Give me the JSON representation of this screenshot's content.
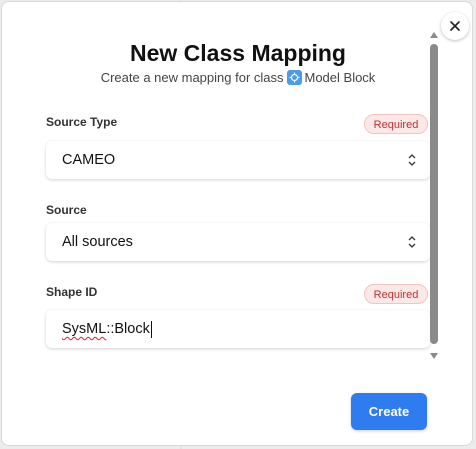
{
  "dialog": {
    "title": "New Class Mapping",
    "subtitle_prefix": "Create a new mapping for class",
    "class_icon": "model-block-icon",
    "class_name": "Model Block"
  },
  "fields": {
    "source_type": {
      "label": "Source Type",
      "required_label": "Required",
      "value": "CAMEO"
    },
    "source": {
      "label": "Source",
      "value": "All sources"
    },
    "shape_id": {
      "label": "Shape ID",
      "required_label": "Required",
      "value_prefix": "SysML",
      "value_suffix": "::Block"
    }
  },
  "actions": {
    "create_label": "Create",
    "close_icon": "close-icon"
  },
  "colors": {
    "accent": "#2f7cf0",
    "required_bg": "#fde8e8",
    "required_text": "#c03030",
    "class_icon": "#4a9be8"
  }
}
